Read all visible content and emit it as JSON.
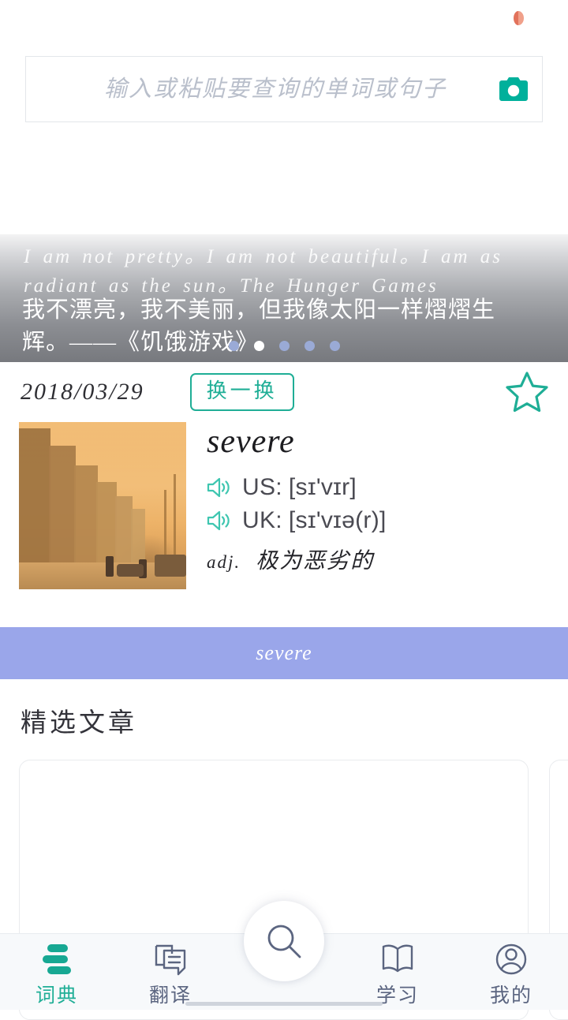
{
  "status_bar": {
    "icon": "half-filled-circle-icon"
  },
  "search": {
    "placeholder": "输入或粘贴要查询的单词或句子",
    "value": "",
    "camera_icon": "camera-icon"
  },
  "quote_banner": {
    "english": "I am not pretty。I am not beautiful。I am as radiant as the sun。The Hunger Games",
    "chinese": "我不漂亮，我不美丽，但我像太阳一样熠熠生辉。——《饥饿游戏》",
    "dots_total": 5,
    "active_dot_index": 1
  },
  "word_card": {
    "date": "2018/03/29",
    "refresh_label": "换一换",
    "favorite_icon": "star-outline-icon",
    "thumbnail_alt": "sandstorm-city-photo",
    "word": "severe",
    "pronunciations": [
      {
        "speaker_icon": "speaker-icon",
        "label": "US:",
        "ipa": "[sɪ'vɪr]"
      },
      {
        "speaker_icon": "speaker-icon",
        "label": "UK:",
        "ipa": "[sɪ'vɪə(r)]"
      }
    ],
    "part_of_speech": "adj.",
    "definition": "极为恶劣的"
  },
  "ad_banner": {
    "text": "severe",
    "color": "#9aa6ea"
  },
  "featured": {
    "title": "精选文章",
    "cards": [
      {
        "content": ""
      },
      {
        "content": ""
      }
    ]
  },
  "bottom_nav": {
    "items": [
      {
        "label": "词典",
        "icon": "dictionary-icon",
        "active": true
      },
      {
        "label": "翻译",
        "icon": "translate-icon",
        "active": false
      },
      {
        "label": "学习",
        "icon": "book-icon",
        "active": false
      },
      {
        "label": "我的",
        "icon": "profile-icon",
        "active": false
      }
    ],
    "fab": {
      "icon": "search-icon"
    }
  },
  "colors": {
    "accent_teal": "#1fae96",
    "nav_inactive": "#5b6580",
    "banner_purple": "#9aa6ea",
    "dot_inactive": "#9aaad6"
  }
}
